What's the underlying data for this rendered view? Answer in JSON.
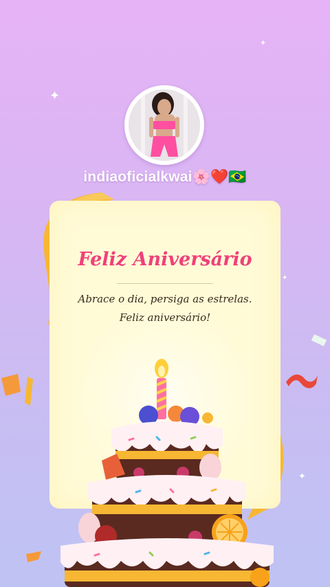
{
  "profile": {
    "username": "indiaoficialkwai",
    "username_emojis": "🌸❤️🇧🇷",
    "avatar": "profile-photo"
  },
  "card": {
    "title": "Feliz Aniversário",
    "message": "Abrace o dia, persiga as estrelas. Feliz aniversário!"
  },
  "decor": {
    "sparkle": "✦",
    "colors": {
      "title": "#f0407a",
      "card_bg": "#fffbd7",
      "ribbon": "#f7b733",
      "frosting": "#fff0f4",
      "cake_brown": "#5a2a20"
    }
  }
}
